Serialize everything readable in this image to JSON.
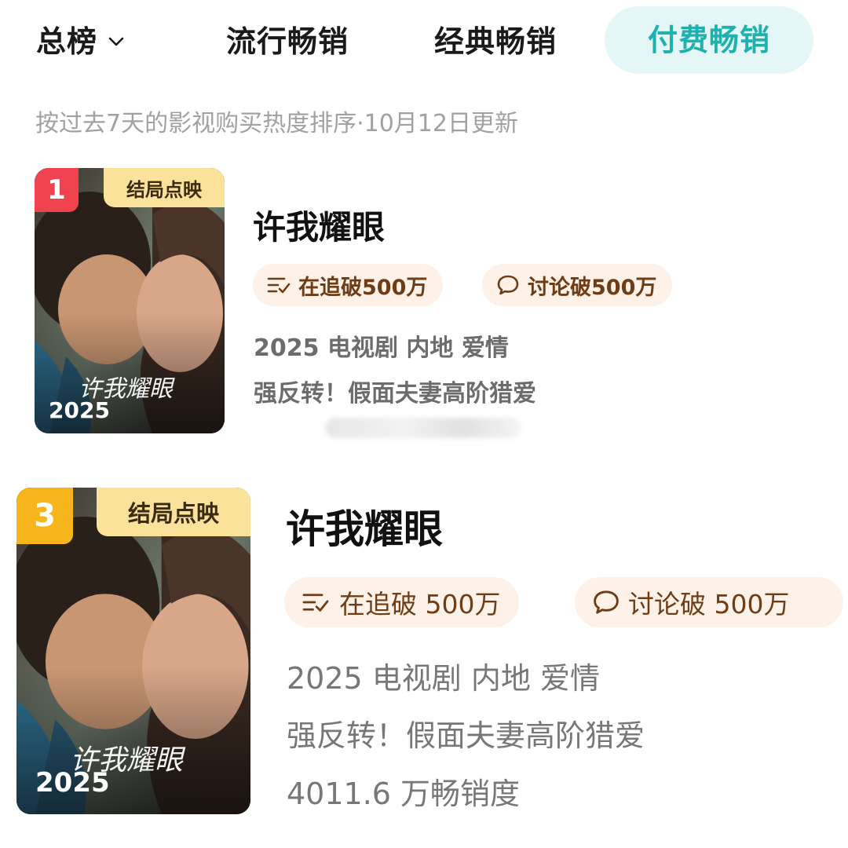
{
  "tabs": {
    "total": "总榜",
    "trending": "流行畅销",
    "classic": "经典畅销",
    "paid": "付费畅销",
    "active": "付费畅销"
  },
  "subtitle": "按过去7天的影视购买热度排序·10月12日更新",
  "items": [
    {
      "rank": "1",
      "rank_color": "#f0424f",
      "badge": "结局点映",
      "poster_logo": "许我耀眼",
      "poster_year": "2025",
      "title": "许我耀眼",
      "chip_follow": "在追破500万",
      "chip_discuss": "讨论破500万",
      "meta": "2025 电视剧 内地 爱情",
      "tagline": "强反转！假面夫妻高阶猎爱"
    },
    {
      "rank": "3",
      "rank_color": "#f5b51b",
      "badge": "结局点映",
      "poster_logo": "许我耀眼",
      "poster_year": "2025",
      "title": "许我耀眼",
      "chip_follow": "在追破 500万",
      "chip_discuss": "讨论破 500万",
      "meta": "2025 电视剧 内地 爱情",
      "tagline": "强反转！假面夫妻高阶猎爱",
      "sales": "4011.6 万畅销度"
    }
  ],
  "colors": {
    "accent": "#1fb1ae",
    "accent_bg": "#e4f6f5",
    "chip_bg": "#fdf1e8",
    "chip_text": "#6e3d16",
    "badge_bg": "#fbe29a"
  },
  "icons": {
    "dropdown": "chevron-down-icon",
    "follow": "list-check-icon",
    "discuss": "chat-bubble-icon"
  }
}
